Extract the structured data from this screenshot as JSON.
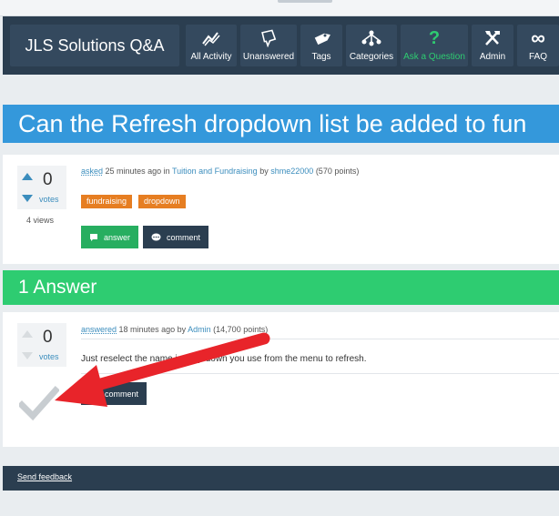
{
  "site": {
    "brand": "JLS Solutions Q&A",
    "nav": [
      {
        "label": "All Activity",
        "icon": "activity-icon"
      },
      {
        "label": "Unanswered",
        "icon": "unanswered-icon"
      },
      {
        "label": "Tags",
        "icon": "tag-icon"
      },
      {
        "label": "Categories",
        "icon": "categories-icon"
      },
      {
        "label": "Ask a Question",
        "icon": "question-icon"
      },
      {
        "label": "Admin",
        "icon": "admin-tools-icon"
      },
      {
        "label": "FAQ",
        "icon": "infinity-icon"
      }
    ]
  },
  "question": {
    "title": "Can the Refresh dropdown list be added to fun",
    "votes": "0",
    "votes_label": "votes",
    "views": "4 views",
    "meta": {
      "asked": "asked",
      "time": "25 minutes ago",
      "in": "in",
      "category": "Tuition and Fundraising",
      "by": "by",
      "user": "shme22000",
      "points": "(570 points)"
    },
    "tags": [
      "fundraising",
      "dropdown"
    ],
    "answer_button": "answer",
    "comment_button": "comment"
  },
  "answers_header": "1 Answer",
  "answer": {
    "votes": "0",
    "votes_label": "votes",
    "meta": {
      "answered": "answered",
      "time": "18 minutes ago",
      "by": "by",
      "user": "Admin",
      "points": "(14,700 points)"
    },
    "text": "Just reselect the name in drop down you use from the menu to refresh.",
    "comment_button": "comment"
  },
  "footer": {
    "feedback": "Send feedback"
  },
  "colors": {
    "navbar": "#2b3e50",
    "title_bar": "#3498db",
    "answer_bar": "#2ecc71",
    "tag": "#e67e22",
    "button_green": "#27ae60",
    "annotation_arrow": "#e8242a"
  }
}
